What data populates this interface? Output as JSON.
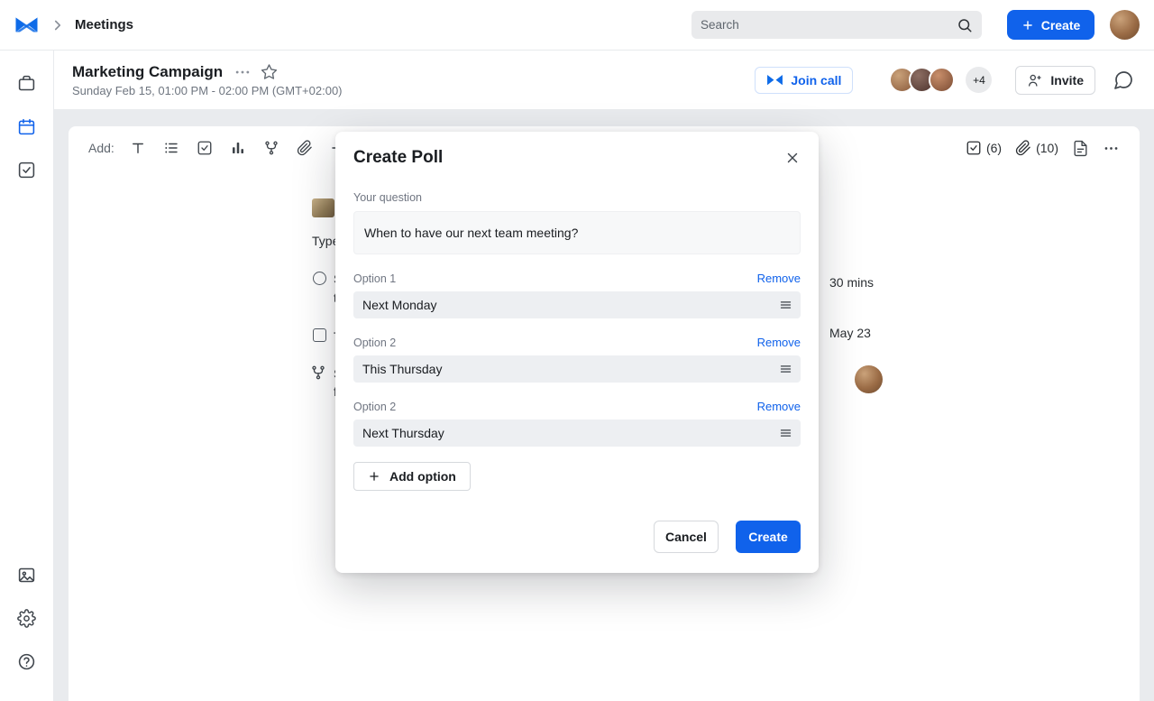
{
  "topbar": {
    "app_title": "Meetings",
    "search_placeholder": "Search",
    "create_label": "Create"
  },
  "meeting_header": {
    "title": "Marketing Campaign",
    "datetime": "Sunday Feb 15, 01:00 PM - 02:00 PM (GMT+02:00)",
    "join_call_label": "Join call",
    "avatar_overflow": "+4",
    "invite_label": "Invite"
  },
  "toolbar": {
    "add_label": "Add:",
    "tasks_count": "(6)",
    "attachments_count": "(10)"
  },
  "document": {
    "type_label": "Type",
    "radio_line1": "S",
    "radio_line2": "t",
    "checkbox_line": "T",
    "fork_line1": "S",
    "fork_line2": "f",
    "duration": "30 mins",
    "date": "May 23"
  },
  "modal": {
    "title": "Create Poll",
    "question_label": "Your question",
    "question_value": "When to have our next team meeting?",
    "remove_label": "Remove",
    "options": [
      {
        "label": "Option 1",
        "value": "Next Monday"
      },
      {
        "label": "Option 2",
        "value": "This Thursday"
      },
      {
        "label": "Option 2",
        "value": "Next Thursday"
      }
    ],
    "add_option_label": "Add option",
    "cancel_label": "Cancel",
    "create_label": "Create"
  },
  "colors": {
    "accent": "#1062eb",
    "topbar_bg": "#ffffff",
    "content_bg": "#e9ebee",
    "option_field_bg": "#edeff2"
  }
}
